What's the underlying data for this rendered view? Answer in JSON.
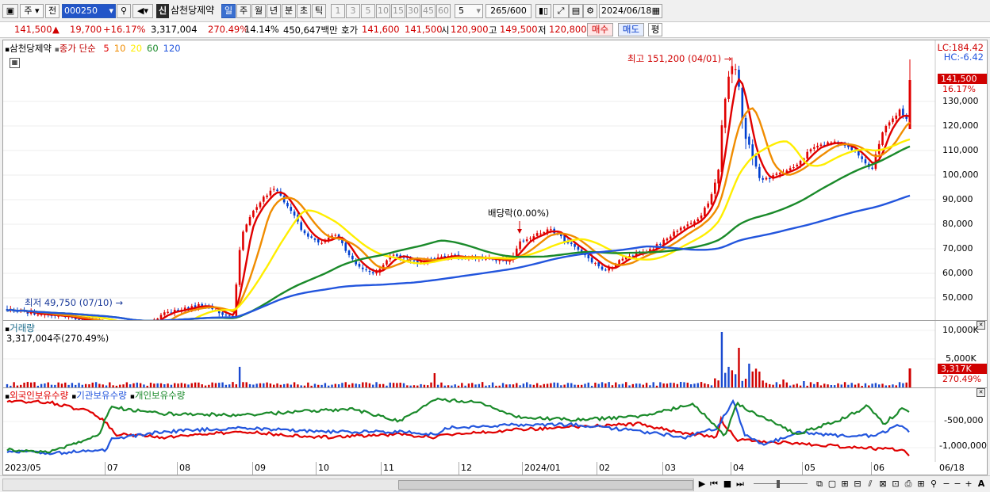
{
  "toolbar": {
    "tab1": "주",
    "tab2": "전",
    "code": "000250",
    "badge": "신",
    "name": "삼천당제약",
    "periods": [
      "일",
      "주",
      "월",
      "년",
      "분",
      "초",
      "틱"
    ],
    "active_period": 0,
    "intervals": [
      "1",
      "3",
      "5",
      "10",
      "15",
      "30",
      "45",
      "60"
    ],
    "count_value": "5",
    "count_range": "265/600",
    "date": "2024/06/18"
  },
  "quote": {
    "price": "141,500",
    "arrow": "▲",
    "change": "19,700",
    "change_pct": "+16.17%",
    "volume": "3,317,004",
    "volume_pct": "270.49%",
    "turnover": "14.14%",
    "amount": "450,647백만",
    "bid_label": "호가",
    "bid": "141,600",
    "ask": "141,500",
    "open_label": "시",
    "open": "120,900",
    "high_label": "고",
    "high": "149,500",
    "low_label": "저",
    "low": "120,800",
    "buy_button": "매수",
    "sell_button": "매도",
    "eval_button": "평"
  },
  "price_panel": {
    "stock_label": "삼천당제약",
    "ma_label": "종가 단순",
    "ma_periods": [
      "5",
      "10",
      "20",
      "60",
      "120"
    ],
    "ma_colors": [
      "#e00000",
      "#f08c00",
      "#ffee00",
      "#1a8a2a",
      "#2255dd"
    ],
    "lc": "LC:184.42",
    "hc": "HC:-6.42",
    "current_price_tag": "141,500",
    "current_pct_tag": "16.17%",
    "high_annotation": "최고 151,200 (04/01)",
    "low_annotation": "최저 49,750 (07/10)",
    "dividend_annotation": "배당락(0.00%)",
    "y_ticks": [
      "130,000",
      "120,000",
      "110,000",
      "100,000",
      "90,000",
      "80,000",
      "70,000",
      "60,000",
      "50,000"
    ]
  },
  "volume_panel": {
    "label": "거래량",
    "value": "3,317,004주(270.49%)",
    "y_ticks": [
      "10,000K",
      "5,000K"
    ],
    "current_tag": "3,317K",
    "current_pct_tag": "270.49%"
  },
  "holding_panel": {
    "series": [
      "외국인보유수량",
      "기관보유수량",
      "개인보유수량"
    ],
    "colors": [
      "#e00000",
      "#2255dd",
      "#1a8a2a"
    ],
    "y_ticks": [
      "-500,000",
      "-1,000,000"
    ]
  },
  "x_axis": [
    "2023/05",
    "07",
    "08",
    "09",
    "10",
    "11",
    "12",
    "2024/01",
    "02",
    "03",
    "04",
    "05",
    "06",
    "06/18"
  ]
}
